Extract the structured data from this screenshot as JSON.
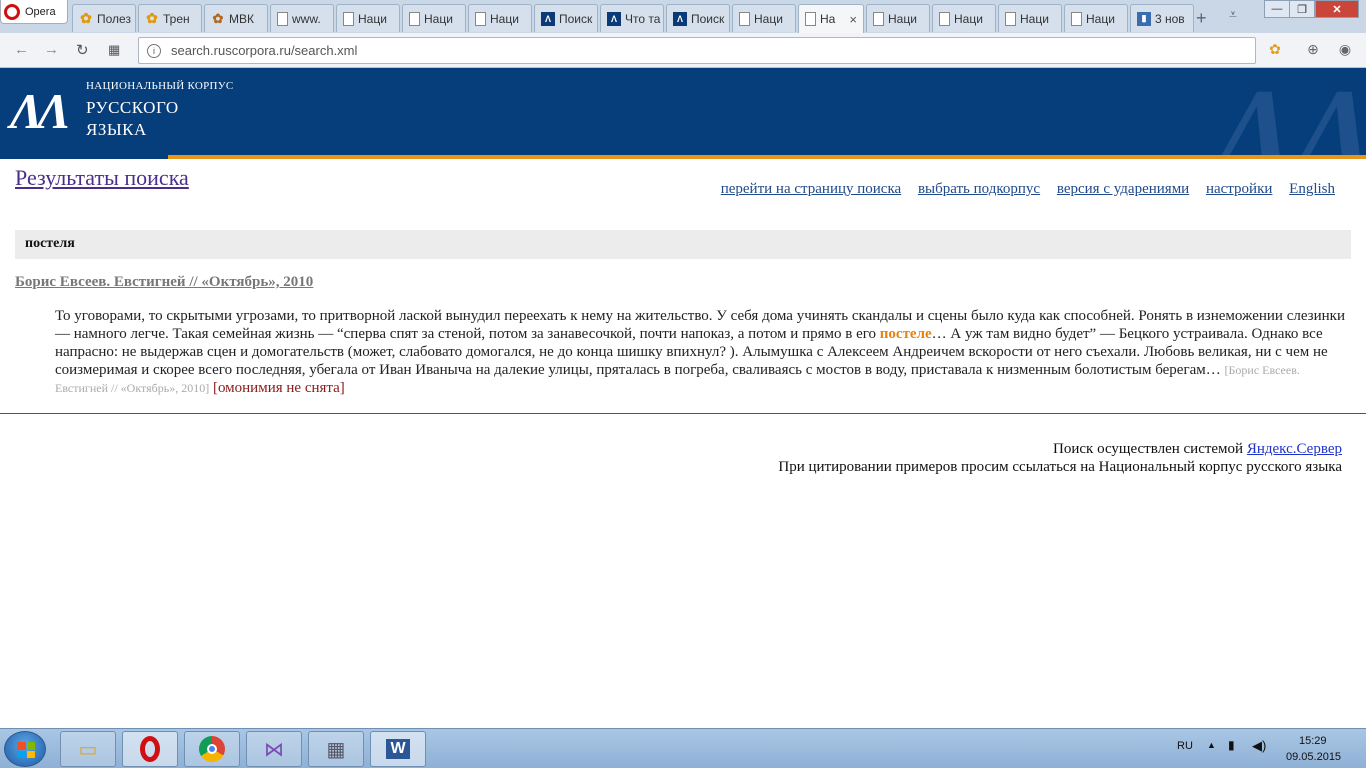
{
  "browser": {
    "menu_label": "Opera",
    "tabs": [
      {
        "label": "Полез",
        "icon": "sun-icon"
      },
      {
        "label": "Трен",
        "icon": "sun-icon"
      },
      {
        "label": "МВК",
        "icon": "leaf-icon"
      },
      {
        "label": "www.",
        "icon": "document-icon"
      },
      {
        "label": "Наци",
        "icon": "document-icon"
      },
      {
        "label": "Наци",
        "icon": "document-icon"
      },
      {
        "label": "Наци",
        "icon": "document-icon"
      },
      {
        "label": "Поиск",
        "icon": "nkrya-icon"
      },
      {
        "label": "Что та",
        "icon": "nkrya-icon"
      },
      {
        "label": "Поиск",
        "icon": "nkrya-icon"
      },
      {
        "label": "Наци",
        "icon": "document-icon"
      },
      {
        "label": "На",
        "icon": "document-icon",
        "active": true,
        "close": "×"
      },
      {
        "label": "Наци",
        "icon": "document-icon"
      },
      {
        "label": "Наци",
        "icon": "document-icon"
      },
      {
        "label": "Наци",
        "icon": "document-icon"
      },
      {
        "label": "Наци",
        "icon": "document-icon"
      },
      {
        "label": "3 нов",
        "icon": "chart-icon"
      }
    ],
    "url": "search.ruscorpora.ru/search.xml"
  },
  "site": {
    "logo_small": "НАЦИОНАЛЬНЫЙ КОРПУС",
    "logo_line1": "РУССКОГО",
    "logo_line2": "ЯЗЫКА"
  },
  "page": {
    "title": "Результаты поиска",
    "links": {
      "search_page": "перейти на страницу поиска",
      "subcorpus": "выбрать подкорпус",
      "stress": "версия с ударениями",
      "settings": "настройки",
      "english": "English"
    },
    "query": "постеля",
    "result": {
      "doc_title": "Борис Евсеев. Евстигней // «Октябрь», 2010",
      "text_before": "То уговорами, то скрытыми угрозами, то притворной лаской вынудил переехать к нему на жительство. У себя дома учинять скандалы и сцены было куда как способней. Ронять в изнеможении слезинки — намного легче. Такая семейная жизнь — “сперва спят за стеной, потом за занавесочкой, почти напоказ, а потом и прямо в его ",
      "highlight": "постеле",
      "text_after": "… А уж там видно будет” — Бецкого устраивала. Однако все напрасно: не выдержав сцен и домогательств (может, слабовато домогался, не до конца шишку впихнул? ). Алымушка с Алексеем Андреичем вскорости от него съехали. Любовь великая, ни с чем не соизмеримая и скорее всего последняя, убегала от Иван Иваныча на далекие улицы, пряталась в погреба, сваливаясь с мостов в воду, приставала к низменным болотистым берегам… ",
      "source": "[Борис Евсеев. Евстигней // «Октябрь», 2010]",
      "homonymy": "[омонимия не снята]"
    },
    "footer": {
      "line1_text": "Поиск осуществлен системой ",
      "line1_link": "Яндекс.Сервер",
      "line2": "При цитировании примеров просим ссылаться на Национальный корпус русского языка"
    }
  },
  "taskbar": {
    "language": "RU",
    "time": "15:29",
    "date": "09.05.2015"
  }
}
